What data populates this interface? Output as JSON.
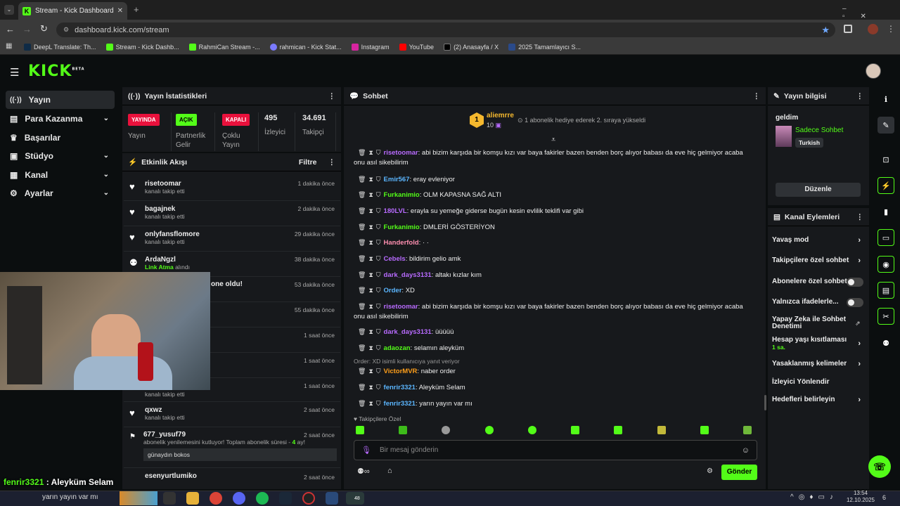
{
  "browser": {
    "tab_title": "Stream - Kick Dashboard",
    "url": "dashboard.kick.com/stream",
    "bookmarks": [
      "DeepL Translate: Th...",
      "Stream - Kick Dashb...",
      "RahmiCan Stream -...",
      "rahmican - Kick Stat...",
      "Instagram",
      "YouTube",
      "(2) Anasayfa / X",
      "2025 Tamamlayıcı S..."
    ]
  },
  "app": {
    "logo": "KICK",
    "logo_beta": "BETA"
  },
  "nav": [
    {
      "label": "Yayın"
    },
    {
      "label": "Para Kazanma"
    },
    {
      "label": "Başarılar"
    },
    {
      "label": "Stüdyo"
    },
    {
      "label": "Kanal"
    },
    {
      "label": "Ayarlar"
    }
  ],
  "stats": {
    "title": "Yayın İstatistikleri",
    "live_badge": "YAYINDA",
    "live_label": "Yayın",
    "partner_badge": "AÇIK",
    "partner_label_1": "Partnerlik",
    "partner_label_2": "Gelir",
    "closed_badge": "KAPALI",
    "closed_label_1": "Çoklu",
    "closed_label_2": "Yayın",
    "viewers": "495",
    "viewers_label": "İzleyici",
    "followers": "34.691",
    "followers_label": "Takipçi"
  },
  "activity": {
    "title": "Etkinlik Akışı",
    "filter": "Filtre",
    "events": [
      {
        "name": "risetoomar",
        "sub": "kanalı takip etti",
        "time": "1 dakika önce"
      },
      {
        "name": "bagajnek",
        "sub": "kanalı takip etti",
        "time": "2 dakika önce"
      },
      {
        "name": "onlyfansflomore",
        "sub": "kanalı takip etti",
        "time": "29 dakika önce"
      },
      {
        "name": "ArdaNgzl",
        "sub_link": "Link Atma",
        "sub_rest": "alındı",
        "time": "38 dakika önce"
      },
      {
        "partial": "one oldu!",
        "time": "53 dakika önce"
      },
      {
        "time": "55 dakika önce"
      },
      {
        "time": "1 saat önce"
      },
      {
        "time": "1 saat önce"
      },
      {
        "sub": "kanalı takip etti",
        "time": "1 saat önce"
      },
      {
        "name": "qxwz",
        "sub": "kanalı takip etti",
        "time": "2 saat önce"
      },
      {
        "name": "677_yusuf79",
        "sub": "abonelik yenilemesini kutluyor! Toplam abonelik süresi -",
        "months": "4",
        "months_suffix": "ay!",
        "message": "günaydın bokos",
        "time": "2 saat önce"
      },
      {
        "name": "esenyurtlumiko",
        "time": "2 saat önce"
      }
    ]
  },
  "chat": {
    "title": "Sohbet",
    "pinned_user": "aliemrre",
    "pinned_rank": "1",
    "pinned_count": "10",
    "pinned_text": "1 abonelik hediye ederek 2. sıraya yükseldi",
    "messages": [
      {
        "user": "risetoomar",
        "color": "#b86bff",
        "text": "abi bizim karşıda bir komşu kızı var baya fakirler bazen benden borç alıyor babası da eve hiç gelmiyor acaba onu asıl sikebilirim"
      },
      {
        "user": "Emir567",
        "color": "#5bb6ff",
        "text": "eray evleniyor"
      },
      {
        "user": "Furkanimio",
        "color": "#53fc18",
        "text": "OLM KAPASNA SAĞ ALTI"
      },
      {
        "user": "180LVL",
        "color": "#b86bff",
        "text": "erayla su yemeğe giderse bugün kesin evlilik teklifi var gibi"
      },
      {
        "user": "Furkanimio",
        "color": "#53fc18",
        "text": "DMLERİ GÖSTERİYON"
      },
      {
        "user": "Handerfold",
        "color": "#ff8fb0",
        "text": "· ·"
      },
      {
        "user": "Cebels",
        "color": "#b86bff",
        "text": "bildirim gelio amk"
      },
      {
        "user": "dark_days3131",
        "color": "#b86bff",
        "text": "altakı kızlar kım"
      },
      {
        "user": "Order",
        "color": "#5bb6ff",
        "text": "XD"
      },
      {
        "user": "risetoomar",
        "color": "#b86bff",
        "text": "abi bizim karşıda bir komşu kızı var baya fakirler bazen benden borç alıyor babası da eve hiç gelmiyor acaba onu asıl sikebilirim"
      },
      {
        "user": "dark_days3131",
        "color": "#b86bff",
        "text": "üüüüü"
      },
      {
        "user": "adaozan",
        "color": "#53fc18",
        "text": "selamın aleyküm"
      },
      {
        "user": "VictorMVR",
        "color": "#ff9f1a",
        "text": "naber order",
        "reply": "Order: XD isimli kullanıcıya yanıt veriyor"
      },
      {
        "user": "fenrir3321",
        "color": "#5bb6ff",
        "text": "Aleyküm Selam"
      },
      {
        "user": "fenrir3321",
        "color": "#5bb6ff",
        "text": "yarın yayın var mı"
      }
    ],
    "follower_only": "Takipçilere Özel",
    "input_placeholder": "Bir mesaj gönderin",
    "send": "Gönder"
  },
  "stream_info": {
    "title": "Yayın bilgisi",
    "stream_title": "geldim",
    "category": "Sadece Sohbet",
    "language": "Turkish",
    "edit": "Düzenle"
  },
  "channel_actions": {
    "title": "Kanal Eylemleri",
    "items": [
      "Yavaş mod",
      "Takipçilere özel sohbet",
      "Abonelere özel sohbet",
      "Yalnızca ifadelerle...",
      "Yapay Zeka ile Sohbet Denetimi",
      "Hesap yaşı kısıtlaması",
      "Yasaklanmış kelimeler",
      "İzleyici Yönlendir",
      "Hedefleri belirleyin"
    ],
    "account_age_value": "1 sa."
  },
  "overlay": {
    "chat_user": "fenrir3321",
    "chat_text": "Aleyküm Selam",
    "ticker": "yarın yayın var mı"
  },
  "taskbar": {
    "time": "13:54",
    "date": "12.10.2025",
    "whatsapp_badge": "48",
    "notif": "6"
  },
  "colors": {
    "accent": "#53fc18",
    "live": "#e9113c",
    "panel": "#17191c",
    "bg": "#0b0e0f"
  }
}
